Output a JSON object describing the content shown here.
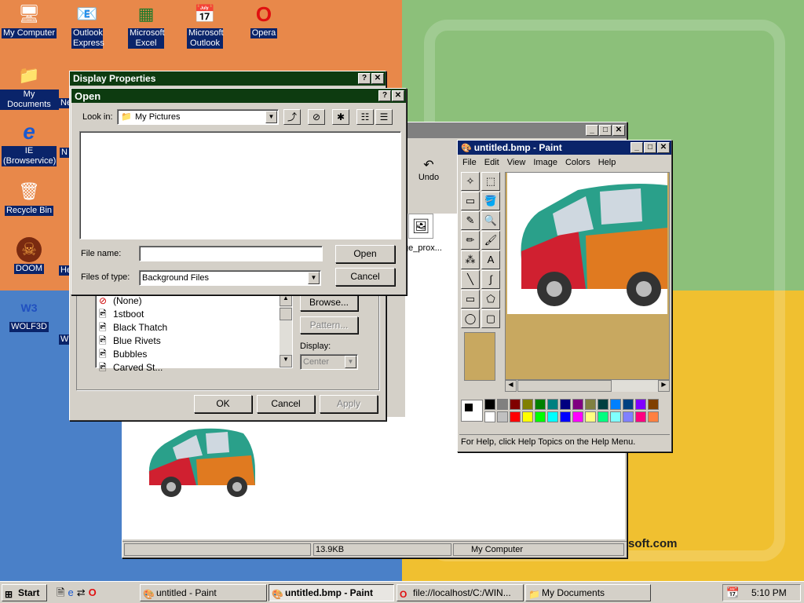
{
  "desktop": {
    "icons": [
      {
        "label": "My Computer",
        "icon": "computer-icon"
      },
      {
        "label": "Outlook Express",
        "icon": "outlook-express-icon"
      },
      {
        "label": "Microsoft Excel",
        "icon": "excel-icon"
      },
      {
        "label": "Microsoft Outlook",
        "icon": "outlook-icon"
      },
      {
        "label": "Opera",
        "icon": "opera-icon"
      },
      {
        "label": "My Documents",
        "icon": "folder-icon"
      },
      {
        "label": "IE (Browservice)",
        "icon": "ie-icon"
      },
      {
        "label": "Recycle Bin",
        "icon": "recycle-bin-icon"
      },
      {
        "label": "DOOM",
        "icon": "doom-icon"
      },
      {
        "label": "WOLF3D",
        "icon": "wolf3d-icon"
      }
    ],
    "partial_labels": [
      "Ne",
      "N",
      "He",
      "W"
    ],
    "watermark": "soft.com"
  },
  "display_properties": {
    "title": "Display Properties",
    "help_btn": "?",
    "close_btn": "✕",
    "wallpapers": [
      "(None)",
      "1stboot",
      "Black Thatch",
      "Blue Rivets",
      "Bubbles",
      "Carved St..."
    ],
    "browse": "Browse...",
    "pattern": "Pattern...",
    "display_label": "Display:",
    "display_value": "Center",
    "ok": "OK",
    "cancel": "Cancel",
    "apply": "Apply"
  },
  "open_dialog": {
    "title": "Open",
    "look_in_label": "Look in:",
    "look_in_value": "My Pictures",
    "file_name_label": "File name:",
    "file_name_value": "",
    "files_of_type_label": "Files of type:",
    "files_of_type_value": "Background Files",
    "open_btn": "Open",
    "cancel_btn": "Cancel"
  },
  "explorer": {
    "undo": "Undo",
    "file_item": "ge_prox...",
    "status_size": "13.9KB",
    "status_location": "My Computer"
  },
  "paint": {
    "title": "untitled.bmp - Paint",
    "menu": [
      "File",
      "Edit",
      "View",
      "Image",
      "Colors",
      "Help"
    ],
    "status": "For Help, click Help Topics on the Help Menu.",
    "palette": [
      "#000000",
      "#808080",
      "#800000",
      "#808000",
      "#008000",
      "#008080",
      "#000080",
      "#800080",
      "#808040",
      "#004040",
      "#0080ff",
      "#004080",
      "#8000ff",
      "#804000",
      "#ffffff",
      "#c0c0c0",
      "#ff0000",
      "#ffff00",
      "#00ff00",
      "#00ffff",
      "#0000ff",
      "#ff00ff",
      "#ffff80",
      "#00ff80",
      "#80ffff",
      "#8080ff",
      "#ff0080",
      "#ff8040"
    ]
  },
  "taskbar": {
    "start": "Start",
    "buttons": [
      "untitled - Paint",
      "untitled.bmp - Paint",
      "file://localhost/C:/WIN...",
      "My Documents"
    ],
    "clock": "5:10 PM"
  }
}
